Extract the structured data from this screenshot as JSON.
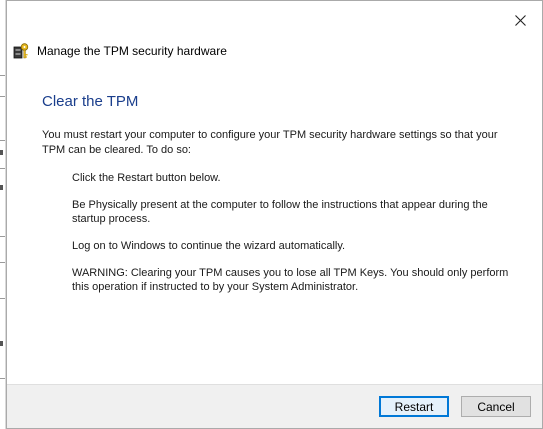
{
  "header": {
    "title": "Manage the TPM security hardware"
  },
  "main": {
    "heading": "Clear the TPM",
    "intro": "You must restart your computer to configure your TPM security hardware settings so that your TPM can be cleared. To do so:",
    "steps": [
      "Click the Restart button below.",
      "Be Physically present at the computer to follow the instructions that appear during the startup process.",
      "Log on to Windows to continue the wizard automatically.",
      "WARNING: Clearing your TPM causes you to lose all TPM Keys. You should only perform this operation if instructed to by your System Administrator."
    ]
  },
  "footer": {
    "restart_label": "Restart",
    "cancel_label": "Cancel"
  },
  "colors": {
    "heading": "#1a3e8c",
    "primary_border": "#0078d7"
  },
  "icons": {
    "close": "close-icon",
    "header": "tpm-chip-key-icon"
  }
}
